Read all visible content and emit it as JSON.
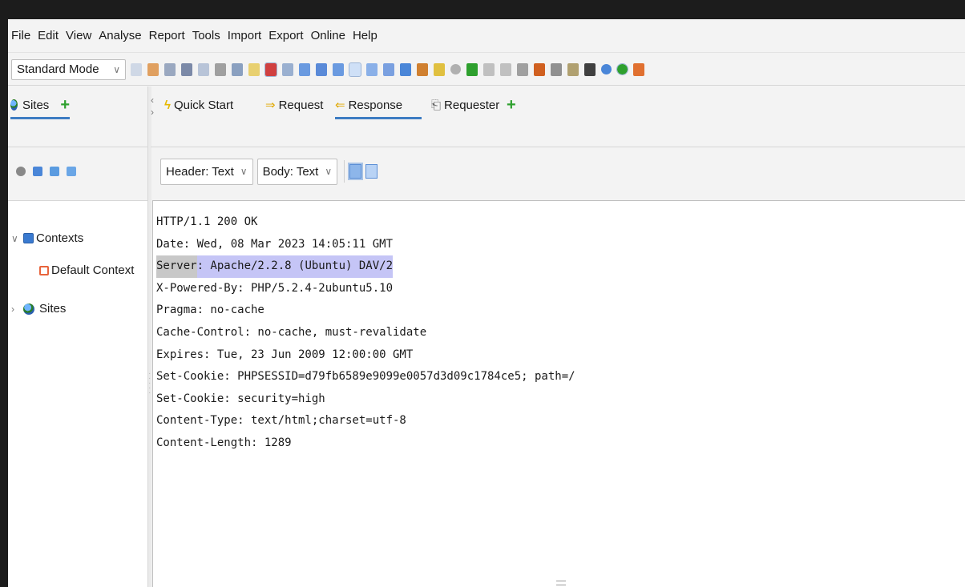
{
  "menu": [
    "File",
    "Edit",
    "View",
    "Analyse",
    "Report",
    "Tools",
    "Import",
    "Export",
    "Online",
    "Help"
  ],
  "toolbar": {
    "mode": "Standard Mode",
    "icons": [
      "new-session-icon",
      "open-session-icon",
      "persist-session-icon",
      "snapshot-icon",
      "session-properties-icon",
      "options-icon",
      "layout-icon",
      "expand-sites-icon",
      "expand-info-icon",
      "layout-full-icon",
      "layout-tabs-icon",
      "layout-side-icon",
      "layout-below-icon",
      "show-all-tabs-icon",
      "pin-tabs-icon",
      "unpin-tabs-icon",
      "proxy-icon",
      "break-icon",
      "hint-icon",
      "set-break-icon",
      "step-icon",
      "continue-icon",
      "drop-icon",
      "remove-break-icon",
      "fuzz-icon",
      "scan-policy-icon",
      "request-icon",
      "manage-addons-icon",
      "add-note-icon",
      "hud-icon",
      "firefox-icon"
    ]
  },
  "left": {
    "sites_tab": "Sites",
    "tree": {
      "contexts": "Contexts",
      "default_context": "Default Context",
      "sites": "Sites"
    }
  },
  "tabs": {
    "quick_start": "Quick Start",
    "request": "Request",
    "response": "Response",
    "requester": "Requester"
  },
  "view": {
    "header": "Header: Text",
    "body": "Body: Text"
  },
  "response": {
    "lines": [
      "HTTP/1.1 200 OK",
      "Date: Wed, 08 Mar 2023 14:05:11 GMT",
      "Server: Apache/2.2.8 (Ubuntu) DAV/2",
      "X-Powered-By: PHP/5.2.4-2ubuntu5.10",
      "Pragma: no-cache",
      "Cache-Control: no-cache, must-revalidate",
      "Expires: Tue, 23 Jun 2009 12:00:00 GMT",
      "Set-Cookie: PHPSESSID=d79fb6589e9099e0057d3d09c1784ce5; path=/",
      "Set-Cookie: security=high",
      "Content-Type: text/html;charset=utf-8",
      "Content-Length: 1289"
    ],
    "highlight_key": "Server",
    "highlight_val": ": Apache/2.2.8 (Ubuntu) DAV/2"
  },
  "colors": {
    "accent": "#3d7cc2",
    "highlight_val": "#c5c5f6",
    "highlight_key": "#c8c8c8",
    "add": "#2ea02e"
  }
}
